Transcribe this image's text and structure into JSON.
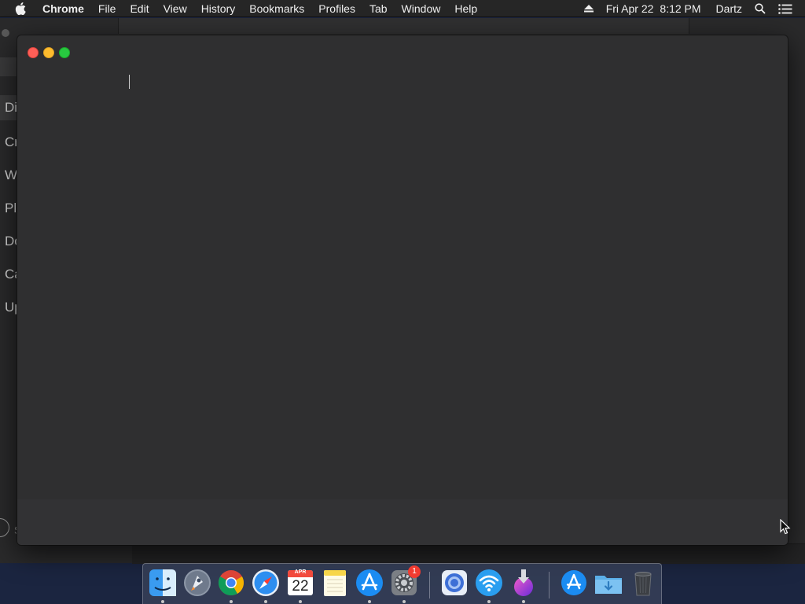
{
  "menubar": {
    "app_name": "Chrome",
    "menus": [
      "File",
      "Edit",
      "View",
      "History",
      "Bookmarks",
      "Profiles",
      "Tab",
      "Window",
      "Help"
    ],
    "date": "Fri Apr 22",
    "time": "8:12 PM",
    "user": "Dartz"
  },
  "background_app": {
    "sidebar_items": [
      "Di",
      "Cr",
      "W",
      "Pl",
      "Do",
      "Ca",
      "Up"
    ],
    "bottom_text": "S"
  },
  "dock": {
    "calendar_month": "APR",
    "calendar_day": "22",
    "system_prefs_badge": "1",
    "icons": [
      "finder-icon",
      "launchpad-icon",
      "chrome-icon",
      "safari-icon",
      "calendar-icon",
      "notes-icon",
      "app-store-icon",
      "system-preferences-icon",
      "chromium-icon",
      "wifi-icon",
      "installer-icon",
      "app-store-folder-icon",
      "downloads-folder-icon",
      "trash-icon"
    ]
  }
}
